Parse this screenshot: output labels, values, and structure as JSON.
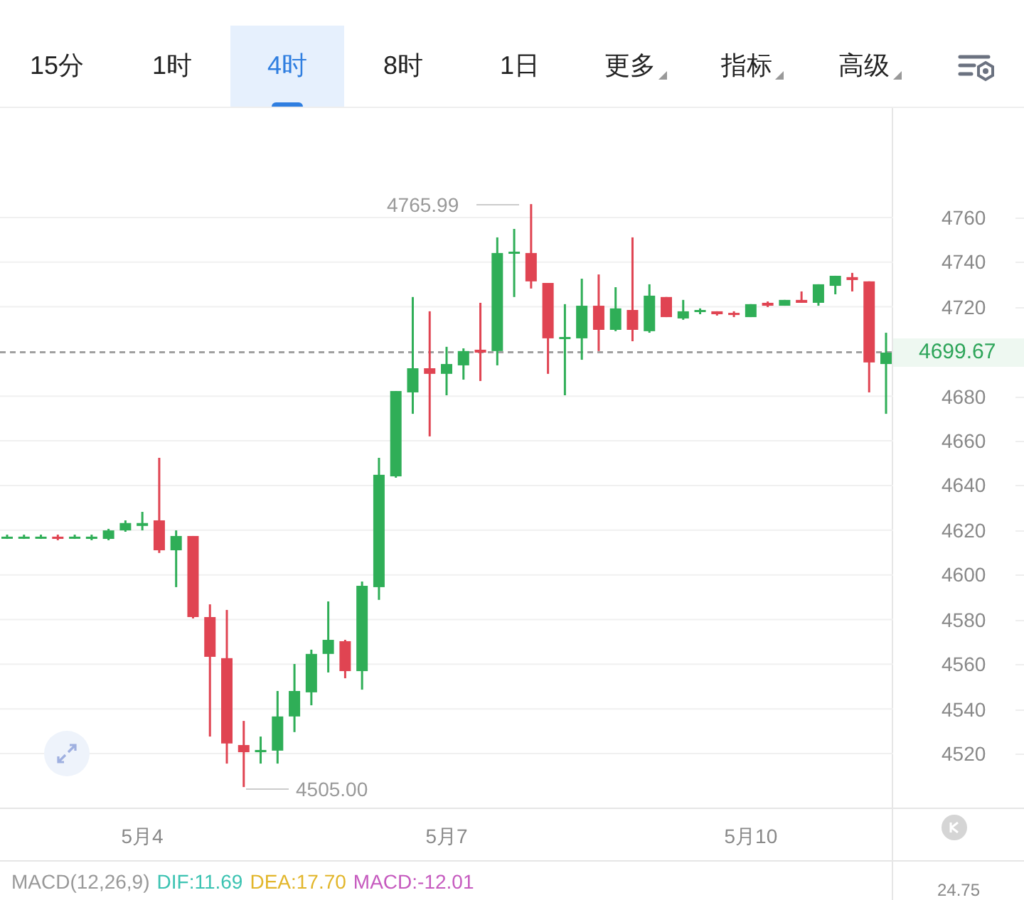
{
  "tabs": [
    {
      "label": "15分",
      "selected": false,
      "kind": "plain"
    },
    {
      "label": "1时",
      "selected": false,
      "kind": "plain"
    },
    {
      "label": "4时",
      "selected": true,
      "kind": "plain"
    },
    {
      "label": "8时",
      "selected": false,
      "kind": "plain"
    },
    {
      "label": "1日",
      "selected": false,
      "kind": "plain"
    },
    {
      "label": "更多",
      "selected": false,
      "kind": "dropdown"
    },
    {
      "label": "指标",
      "selected": false,
      "kind": "dropdown"
    },
    {
      "label": "高级",
      "selected": false,
      "kind": "dropdown"
    }
  ],
  "chart": {
    "current_price": "4699.67",
    "high_label": "4765.99",
    "low_label": "4505.00",
    "chart_data": {
      "type": "candlestick",
      "categories": [
        null,
        null,
        null,
        null,
        null,
        null,
        null,
        null,
        "5月4",
        null,
        null,
        null,
        null,
        null,
        null,
        null,
        null,
        null,
        null,
        null,
        null,
        null,
        null,
        null,
        null,
        null,
        "5月7",
        null,
        null,
        null,
        null,
        null,
        null,
        null,
        null,
        null,
        null,
        null,
        null,
        null,
        null,
        null,
        null,
        null,
        "5月10",
        null,
        null,
        null,
        null,
        null,
        null,
        null,
        null
      ],
      "ohlc": [
        [
          4616.4,
          4618.0,
          4616.1,
          4617.1
        ],
        [
          4616.4,
          4618.0,
          4616.1,
          4617.1
        ],
        [
          4616.4,
          4618.0,
          4616.1,
          4617.1
        ],
        [
          4617.1,
          4618.0,
          4615.5,
          4616.1
        ],
        [
          4616.4,
          4618.0,
          4616.1,
          4617.1
        ],
        [
          4616.1,
          4618.0,
          4615.5,
          4617.1
        ],
        [
          4616.1,
          4620.6,
          4615.5,
          4619.9
        ],
        [
          4619.9,
          4624.4,
          4619.3,
          4623.2
        ],
        [
          4621.9,
          4628.2,
          4619.9,
          4623.2
        ],
        [
          4624.4,
          4652.4,
          4609.8,
          4611.0
        ],
        [
          4611.0,
          4619.9,
          4594.5,
          4617.4
        ],
        [
          4617.4,
          4617.4,
          4580.5,
          4581.1
        ],
        [
          4581.1,
          4586.8,
          4527.6,
          4563.3
        ],
        [
          4562.7,
          4584.3,
          4515.5,
          4524.5
        ],
        [
          4523.8,
          4534.6,
          4505.0,
          4520.6
        ],
        [
          4520.6,
          4527.6,
          4515.5,
          4521.6
        ],
        [
          4521.3,
          4548.0,
          4515.5,
          4536.6
        ],
        [
          4536.6,
          4560.1,
          4529.6,
          4548.0
        ],
        [
          4547.4,
          4566.5,
          4541.6,
          4564.6
        ],
        [
          4564.6,
          4588.1,
          4556.3,
          4570.9
        ],
        [
          4570.3,
          4570.9,
          4553.7,
          4556.9
        ],
        [
          4556.9,
          4597.0,
          4548.6,
          4595.1
        ],
        [
          4594.5,
          4652.4,
          4588.8,
          4644.8
        ],
        [
          4644.1,
          4682.3,
          4643.5,
          4682.3
        ],
        [
          4681.7,
          4724.4,
          4672.1,
          4692.5
        ],
        [
          4692.5,
          4718.0,
          4662.0,
          4690.0
        ],
        [
          4690.0,
          4702.1,
          4680.4,
          4694.4
        ],
        [
          4693.8,
          4701.4,
          4687.4,
          4700.2
        ],
        [
          4700.8,
          4721.8,
          4686.8,
          4699.5
        ],
        [
          4700.2,
          4751.1,
          4693.8,
          4744.1
        ],
        [
          4743.8,
          4754.9,
          4724.4,
          4744.7
        ],
        [
          4744.1,
          4766.0,
          4728.2,
          4731.4
        ],
        [
          4730.7,
          4730.7,
          4690.0,
          4705.9
        ],
        [
          4705.6,
          4721.2,
          4680.4,
          4706.5
        ],
        [
          4705.9,
          4732.6,
          4696.3,
          4720.5
        ],
        [
          4720.5,
          4734.5,
          4700.2,
          4709.7
        ],
        [
          4709.7,
          4728.8,
          4709.1,
          4719.3
        ],
        [
          4718.6,
          4751.1,
          4704.6,
          4709.7
        ],
        [
          4709.1,
          4730.1,
          4708.4,
          4725.0
        ],
        [
          4724.4,
          4724.4,
          4715.4,
          4715.4
        ],
        [
          4714.8,
          4723.1,
          4714.2,
          4718.0
        ],
        [
          4717.7,
          4719.3,
          4716.7,
          4718.6
        ],
        [
          4718.0,
          4718.0,
          4716.1,
          4716.7
        ],
        [
          4717.3,
          4718.0,
          4715.4,
          4716.4
        ],
        [
          4715.4,
          4721.2,
          4715.4,
          4721.2
        ],
        [
          4721.8,
          4722.4,
          4719.9,
          4720.5
        ],
        [
          4720.5,
          4723.1,
          4720.5,
          4723.1
        ],
        [
          4723.1,
          4726.9,
          4721.8,
          4721.8
        ],
        [
          4721.8,
          4730.1,
          4720.5,
          4730.1
        ],
        [
          4729.4,
          4733.9,
          4725.6,
          4733.9
        ],
        [
          4733.3,
          4735.2,
          4726.9,
          4732.0
        ],
        [
          4731.4,
          4731.4,
          4681.7,
          4695.1
        ],
        [
          4694.4,
          4708.4,
          4672.1,
          4699.5
        ]
      ],
      "ylim": [
        4495.8,
        4809.0
      ],
      "grid": true,
      "ref_lines": [
        {
          "axis": "y",
          "value": 4699.67
        }
      ],
      "yticks": [
        {
          "value": 4760,
          "label": "4760"
        },
        {
          "value": 4740,
          "label": "4740"
        },
        {
          "value": 4720,
          "label": "4720"
        },
        {
          "value": 4680,
          "label": "4680"
        },
        {
          "value": 4660,
          "label": "4660"
        },
        {
          "value": 4640,
          "label": "4640"
        },
        {
          "value": 4620,
          "label": "4620"
        },
        {
          "value": 4600,
          "label": "4600"
        },
        {
          "value": 4580,
          "label": "4580"
        },
        {
          "value": 4560,
          "label": "4560"
        },
        {
          "value": 4540,
          "label": "4540"
        },
        {
          "value": 4520,
          "label": "4520"
        }
      ]
    }
  },
  "macd": {
    "label": "MACD(12,26,9)",
    "values": [
      {
        "text": "DIF:11.69",
        "color": "#3cc3b2"
      },
      {
        "text": "DEA:17.70",
        "color": "#e2b62b"
      },
      {
        "text": "MACD:-12.01",
        "color": "#c65bbf"
      }
    ],
    "axis_label": "24.75"
  }
}
